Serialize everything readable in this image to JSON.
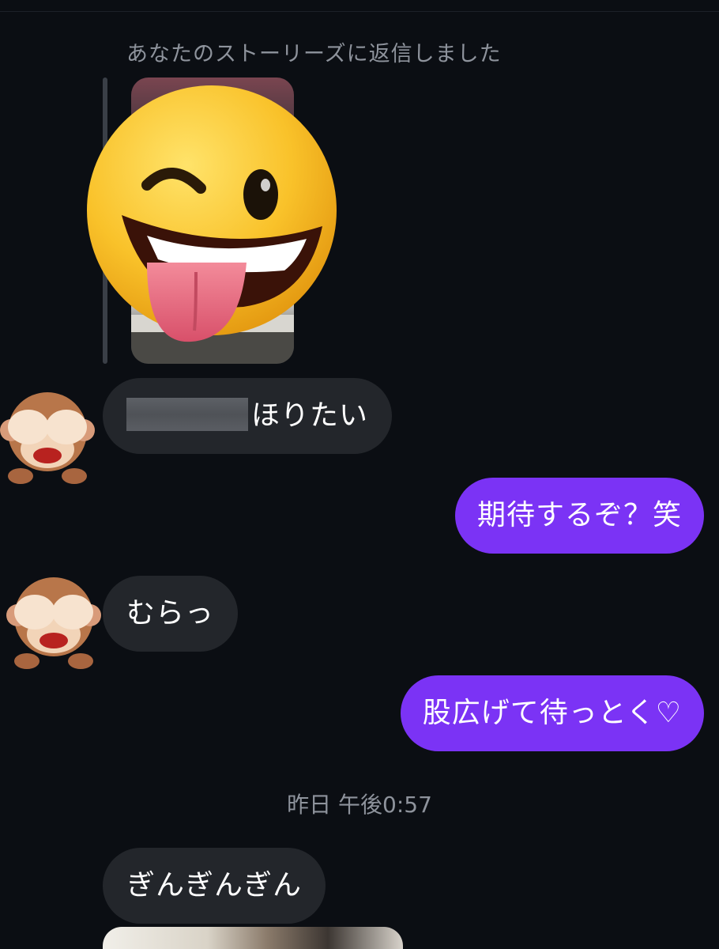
{
  "thread": {
    "story_reply_caption": "あなたのストーリーズに返信しました",
    "story_reaction_icon": "winking-face-with-tongue-emoji",
    "messages": [
      {
        "side": "received",
        "avatar": "see-no-evil-monkey-icon",
        "redacted": true,
        "text": "ほりたい"
      },
      {
        "side": "sent",
        "text": "期待するぞ？笑"
      },
      {
        "side": "received",
        "avatar": "see-no-evil-monkey-icon",
        "text": "むらっ"
      },
      {
        "side": "sent",
        "text": "股広げて待っとく♡"
      }
    ],
    "timestamp": "昨日 午後0:57",
    "messages_after": [
      {
        "side": "received",
        "text": "ぎんぎんぎん"
      }
    ]
  },
  "colors": {
    "background": "#0b0e13",
    "received_bubble": "#23262b",
    "sent_bubble": "#7b33f5",
    "meta_text": "#8e939c"
  }
}
